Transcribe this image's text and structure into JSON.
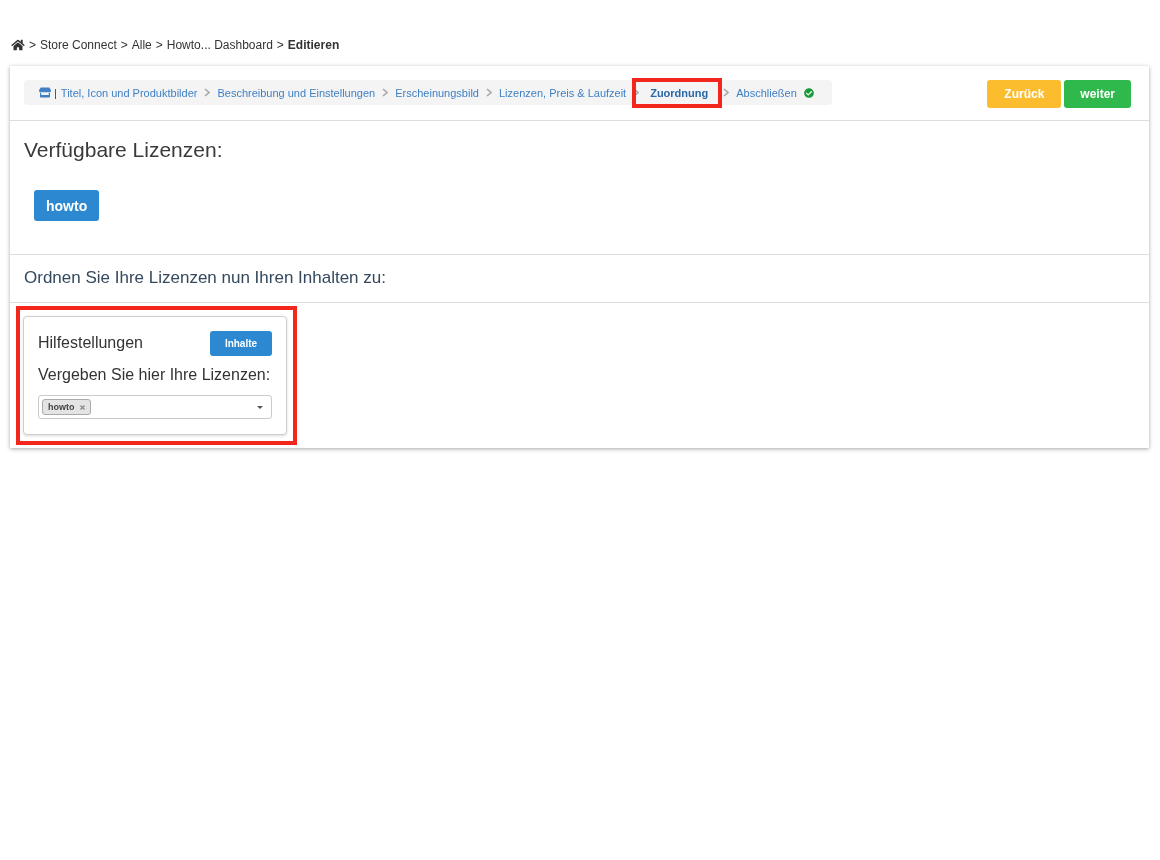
{
  "breadcrumb": {
    "items": [
      {
        "separator": ">",
        "label": "Store Connect",
        "current": false
      },
      {
        "separator": ">",
        "label": "Alle",
        "current": false
      },
      {
        "separator": ">",
        "label": "Howto... Dashboard",
        "current": false
      },
      {
        "separator": ">",
        "label": "Editieren",
        "current": true
      }
    ]
  },
  "wizard": {
    "steps": [
      {
        "kind": "home",
        "prefix": "|",
        "label": "Titel, Icon und Produktbilder",
        "selected": false,
        "highlighted": false
      },
      {
        "kind": "step",
        "label": "Beschreibung und Einstellungen",
        "selected": false,
        "highlighted": false
      },
      {
        "kind": "step",
        "label": "Erscheinungsbild",
        "selected": false,
        "highlighted": false
      },
      {
        "kind": "step",
        "label": "Lizenzen, Preis & Laufzeit",
        "selected": false,
        "highlighted": false
      },
      {
        "kind": "step",
        "label": "Zuordnung",
        "selected": true,
        "highlighted": true
      },
      {
        "kind": "finish",
        "label": "Abschließen",
        "selected": false,
        "highlighted": false
      }
    ],
    "buttons": [
      {
        "kind": "back",
        "label": "Zurück"
      },
      {
        "kind": "next",
        "label": "weiter"
      }
    ]
  },
  "licenses": {
    "title": "Verfügbare Lizenzen:",
    "items": [
      {
        "label": "howto"
      }
    ]
  },
  "assignment": {
    "title": "Ordnen Sie Ihre Lizenzen nun Ihren Inhalten zu:",
    "cards": [
      {
        "title": "Hilfestellungen",
        "button": "Inhalte",
        "prompt": "Vergeben Sie hier Ihre Lizenzen:",
        "highlighted": true,
        "select": {
          "tags": [
            {
              "label": "howto"
            }
          ]
        }
      }
    ]
  }
}
